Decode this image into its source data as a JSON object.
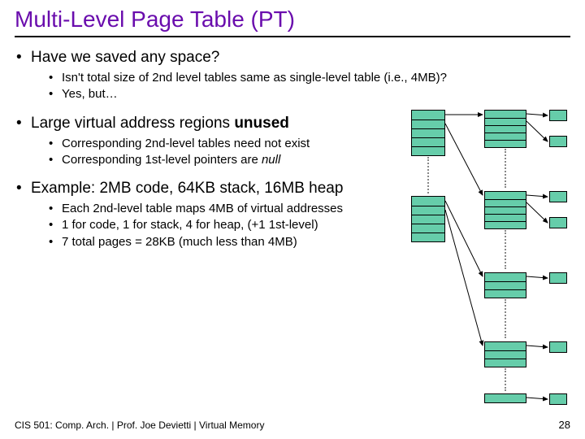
{
  "title": "Multi-Level Page Table (PT)",
  "bullets": {
    "b1": "Have we saved any space?",
    "b1a": "Isn't total size of 2nd level tables same as single-level table (i.e., 4MB)?",
    "b1b": "Yes, but…",
    "b2_pre": "Large virtual address regions ",
    "b2_bold": "unused",
    "b2a": "Corresponding 2nd-level tables need not exist",
    "b2b_pre": "Corresponding 1st-level pointers are ",
    "b2b_it": "null",
    "b3": "Example: 2MB code, 64KB stack, 16MB heap",
    "b3a": "Each 2nd-level table maps 4MB of virtual addresses",
    "b3b": "1 for code, 1 for stack, 4 for heap, (+1 1st-level)",
    "b3c": "7 total pages = 28KB (much less than 4MB)"
  },
  "footer": "CIS 501: Comp. Arch.  |  Prof. Joe Devietti  |  Virtual Memory",
  "page_number": "28"
}
